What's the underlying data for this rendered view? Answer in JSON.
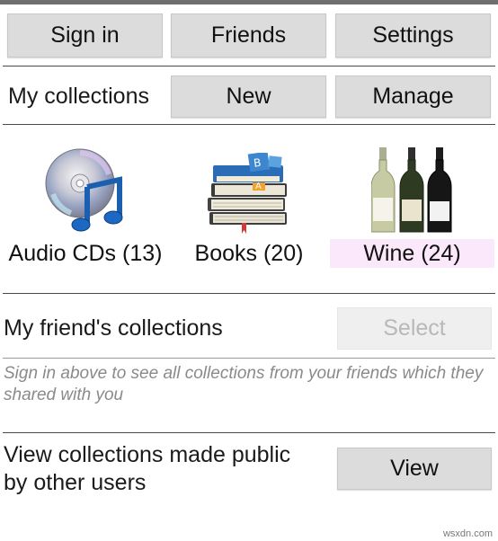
{
  "toolbar": {
    "sign_in": "Sign in",
    "friends": "Friends",
    "settings": "Settings"
  },
  "my_collections": {
    "heading": "My collections",
    "new_label": "New",
    "manage_label": "Manage",
    "items": [
      {
        "label": "Audio CDs (13)",
        "icon": "audio-cd-icon"
      },
      {
        "label": "Books (20)",
        "icon": "books-icon"
      },
      {
        "label": "Wine (24)",
        "icon": "wine-bottles-icon"
      }
    ],
    "selected_index": 2,
    "selected_color": "#fbe9fb"
  },
  "friends_collections": {
    "heading": "My friend's collections",
    "select_label": "Select",
    "hint": "Sign in above to see all collections from your friends which they shared with you"
  },
  "public_collections": {
    "heading_line1": "View collections made public",
    "heading_line2": "by other users",
    "view_label": "View"
  },
  "watermark": "wsxdn.com"
}
